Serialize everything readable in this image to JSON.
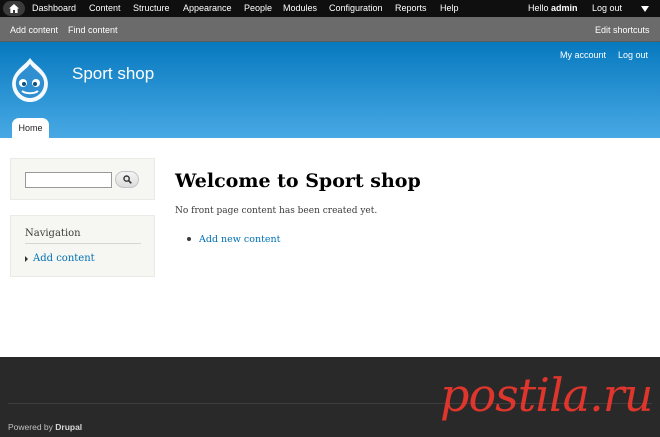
{
  "toolbar": {
    "items": [
      "Dashboard",
      "Content",
      "Structure",
      "Appearance",
      "People",
      "Modules",
      "Configuration",
      "Reports",
      "Help"
    ],
    "hello_prefix": "Hello ",
    "username": "admin",
    "logout": "Log out"
  },
  "shortcuts": {
    "add_content": "Add content",
    "find_content": "Find content",
    "edit_shortcuts": "Edit shortcuts"
  },
  "header": {
    "site_name": "Sport shop",
    "my_account": "My account",
    "log_out": "Log out",
    "tab_home": "Home"
  },
  "search": {
    "value": ""
  },
  "navigation": {
    "title": "Navigation",
    "items": [
      "Add content"
    ]
  },
  "main": {
    "title": "Welcome to Sport shop",
    "message": "No front page content has been created yet.",
    "action_link": "Add new content"
  },
  "footer": {
    "powered_prefix": "Powered by ",
    "powered_link": "Drupal",
    "watermark": "postila.ru"
  },
  "colors": {
    "header_top": "#0779bf",
    "header_bottom": "#48a9e4",
    "link": "#0071b3",
    "footer_bg": "#292929",
    "toolbar_bg": "#0f0f0f",
    "shortcut_bg": "#6b6b6b",
    "watermark": "#e8362d"
  }
}
